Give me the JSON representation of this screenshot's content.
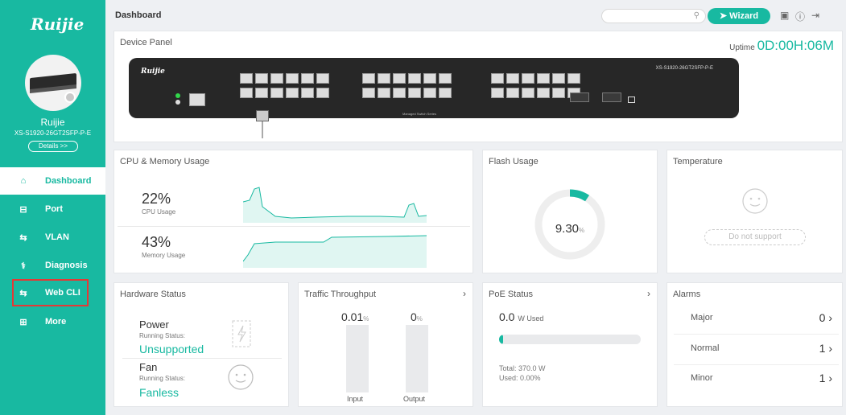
{
  "sidebar": {
    "logo": "Ruijie",
    "device_name": "Ruijie",
    "device_model": "XS-S1920-26GT2SFP-P-E",
    "details_label": "Details >>",
    "items": [
      {
        "label": "Dashboard",
        "icon": "home-icon",
        "glyph": "⌂"
      },
      {
        "label": "Port",
        "icon": "port-icon",
        "glyph": "⊟"
      },
      {
        "label": "VLAN",
        "icon": "vlan-icon",
        "glyph": "⇆"
      },
      {
        "label": "Diagnosis",
        "icon": "diagnosis-icon",
        "glyph": "⚕"
      },
      {
        "label": "Web CLI",
        "icon": "web-cli-icon",
        "glyph": "⇆"
      },
      {
        "label": "More",
        "icon": "more-icon",
        "glyph": "⊞"
      }
    ]
  },
  "topbar": {
    "title": "Dashboard",
    "search_placeholder": "",
    "wizard_label": "Wizard"
  },
  "device_panel": {
    "title": "Device Panel",
    "uptime_label": "Uptime",
    "uptime_value": "0D:00H:06M",
    "switch_logo": "Ruijie",
    "switch_model": "XS-S1920-26GT2SFP-P-E",
    "switch_subtitle": "Managed Switch Series"
  },
  "cpu_memory": {
    "title": "CPU & Memory Usage",
    "cpu_value": "22%",
    "cpu_label": "CPU Usage",
    "memory_value": "43%",
    "memory_label": "Memory Usage"
  },
  "flash": {
    "title": "Flash Usage",
    "value": "9.30",
    "unit": "%",
    "fraction": 0.093
  },
  "temperature": {
    "title": "Temperature",
    "status": "Do not support"
  },
  "hardware": {
    "title": "Hardware Status",
    "power_name": "Power",
    "power_sub": "Running Status:",
    "power_status": "Unsupported",
    "fan_name": "Fan",
    "fan_sub": "Running Status:",
    "fan_status": "Fanless"
  },
  "traffic": {
    "title": "Traffic Throughput",
    "input_value": "0.01",
    "input_unit": "%",
    "output_value": "0",
    "output_unit": "%",
    "input_label": "Input",
    "output_label": "Output"
  },
  "poe": {
    "title": "PoE Status",
    "used_value": "0.0",
    "used_unit": "W Used",
    "total": "Total: 370.0 W",
    "used_pct": "Used: 0.00%",
    "fraction": 0.0
  },
  "alarms": {
    "title": "Alarms",
    "rows": [
      {
        "name": "Major",
        "count": "0"
      },
      {
        "name": "Normal",
        "count": "1"
      },
      {
        "name": "Minor",
        "count": "1"
      }
    ]
  },
  "colors": {
    "accent": "#18b9a1",
    "highlight": "#e53935"
  }
}
